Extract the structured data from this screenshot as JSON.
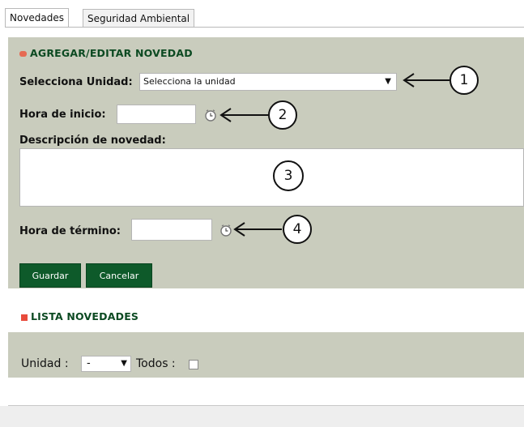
{
  "tabs": [
    {
      "label": "Novedades",
      "active": true
    },
    {
      "label": "Seguridad Ambiental",
      "active": false
    }
  ],
  "form": {
    "heading": "AGREGAR/EDITAR NOVEDAD",
    "unidad_label": "Selecciona Unidad:",
    "unidad_value": "Selecciona la unidad",
    "hora_inicio_label": "Hora de inicio:",
    "hora_inicio_value": "",
    "descripcion_label": "Descripción de novedad:",
    "descripcion_value": "",
    "hora_termino_label": "Hora de término:",
    "hora_termino_value": "",
    "save_label": "Guardar",
    "cancel_label": "Cancelar"
  },
  "callouts": [
    "1",
    "2",
    "3",
    "4"
  ],
  "lista": {
    "heading": "LISTA NOVEDADES",
    "unidad_label": "Unidad :",
    "unidad_value": "-",
    "todos_label": "Todos :"
  },
  "colors": {
    "panel_bg": "#c9ccbd",
    "heading_green": "#0c4a22",
    "button_green": "#0e5a2a",
    "bullet_red": "#e84b3c"
  },
  "icons": [
    "clock-icon",
    "chevron-down-icon",
    "arrow-left-icon",
    "bullet-icon"
  ]
}
